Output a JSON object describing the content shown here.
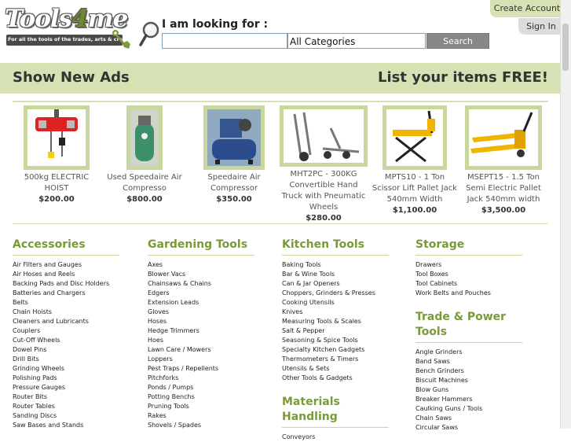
{
  "header": {
    "logo_text_a": "Tools",
    "logo_text_b": "4",
    "logo_text_c": "me",
    "logo_tagline": "For all the tools of the trades, arts & crafts",
    "looking_for": "I am looking for :",
    "search_value": "",
    "category_selected": "All Categories",
    "search_button": "Search",
    "create_account": "Create Account",
    "sign_in": "Sign In"
  },
  "banner": {
    "left": "Show New Ads",
    "right": "List your items FREE!"
  },
  "products": [
    {
      "name": "500kg ELECTRIC HOIST",
      "price": "$200.00"
    },
    {
      "name": "Used Speedaire Air Compresso",
      "price": "$800.00"
    },
    {
      "name": "Speedaire Air Compressor",
      "price": "$350.00"
    },
    {
      "name": "MHT2PC - 300KG Convertible Hand Truck with Pneumatic Wheels",
      "price": "$280.00"
    },
    {
      "name": "MPTS10 - 1 Ton Scissor Lift Pallet Jack 540mm Width",
      "price": "$1,100.00"
    },
    {
      "name": "MSEPT15 - 1.5 Ton Semi Electric Pallet Jack 540mm width",
      "price": "$3,500.00"
    }
  ],
  "categories": {
    "accessories": {
      "title": "Accessories",
      "items": [
        "Air Filters and Gauges",
        "Air Hoses and Reels",
        "Backing Pads and Disc Holders",
        "Batteries and Chargers",
        "Belts",
        "Chain Hoists",
        "Cleaners and Lubricants",
        "Couplers",
        "Cut-Off Wheels",
        "Dowel Pins",
        "Drill Bits",
        "Grinding Wheels",
        "Polishing Pads",
        "Pressure Gauges",
        "Router Bits",
        "Router Tables",
        "Sanding Discs",
        "Saw Bases and Stands"
      ]
    },
    "gardening": {
      "title": "Gardening Tools",
      "items": [
        "Axes",
        "Blower Vacs",
        "Chainsaws & Chains",
        "Edgers",
        "Extension Leads",
        "Gloves",
        "Hoses",
        "Hedge Trimmers",
        "Hoes",
        "Lawn Care / Mowers",
        "Loppers",
        "Pest Traps / Repellents",
        "Pitchforks",
        "Ponds / Pumps",
        "Potting Benchs",
        "Pruning Tools",
        "Rakes",
        "Shovels / Spades"
      ]
    },
    "kitchen": {
      "title": "Kitchen Tools",
      "items": [
        "Baking Tools",
        "Bar & Wine Tools",
        "Can & Jar Openers",
        "Choppers, Grinders & Presses",
        "Cooking Utensils",
        "Knives",
        "Measuring Tools & Scales",
        "Salt & Pepper",
        "Seasoning & Spice Tools",
        "Specialty Kitchen Gadgets",
        "Thermometers & Timers",
        "Utensils & Sets",
        "Other Tools & Gadgets"
      ]
    },
    "materials": {
      "title": "Materials Handling",
      "items": [
        "Conveyors"
      ]
    },
    "storage": {
      "title": "Storage",
      "items": [
        "Drawers",
        "Tool Boxes",
        "Tool Cabinets",
        "Work Belts and Pouches"
      ]
    },
    "trade": {
      "title_a": "Trade & Power",
      "title_b": "Tools",
      "items": [
        "Angle Grinders",
        "Band Saws",
        "Bench Grinders",
        "Biscuit Machines",
        "Blow Guns",
        "Breaker Hammers",
        "Caulking Guns / Tools",
        "Chain Saws",
        "Circular Saws"
      ]
    }
  },
  "colors": {
    "accent_green": "#d6e1b4",
    "title_green": "#7a9a3a",
    "frame_green": "#c8d79d"
  }
}
